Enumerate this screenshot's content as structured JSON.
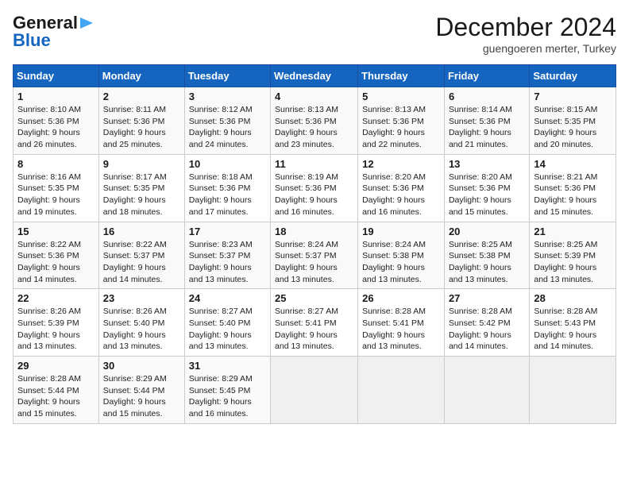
{
  "header": {
    "logo_general": "General",
    "logo_blue": "Blue",
    "title": "December 2024",
    "subtitle": "guengoeren merter, Turkey"
  },
  "calendar": {
    "days_of_week": [
      "Sunday",
      "Monday",
      "Tuesday",
      "Wednesday",
      "Thursday",
      "Friday",
      "Saturday"
    ],
    "weeks": [
      [
        null,
        {
          "day": "2",
          "sunrise": "8:11 AM",
          "sunset": "5:36 PM",
          "daylight": "9 hours and 25 minutes."
        },
        {
          "day": "3",
          "sunrise": "8:12 AM",
          "sunset": "5:36 PM",
          "daylight": "9 hours and 24 minutes."
        },
        {
          "day": "4",
          "sunrise": "8:13 AM",
          "sunset": "5:36 PM",
          "daylight": "9 hours and 23 minutes."
        },
        {
          "day": "5",
          "sunrise": "8:13 AM",
          "sunset": "5:36 PM",
          "daylight": "9 hours and 22 minutes."
        },
        {
          "day": "6",
          "sunrise": "8:14 AM",
          "sunset": "5:36 PM",
          "daylight": "9 hours and 21 minutes."
        },
        {
          "day": "7",
          "sunrise": "8:15 AM",
          "sunset": "5:35 PM",
          "daylight": "9 hours and 20 minutes."
        }
      ],
      [
        {
          "day": "1",
          "sunrise": "8:10 AM",
          "sunset": "5:36 PM",
          "daylight": "9 hours and 26 minutes."
        },
        {
          "day": "9",
          "sunrise": "8:17 AM",
          "sunset": "5:35 PM",
          "daylight": "9 hours and 18 minutes."
        },
        {
          "day": "10",
          "sunrise": "8:18 AM",
          "sunset": "5:36 PM",
          "daylight": "9 hours and 17 minutes."
        },
        {
          "day": "11",
          "sunrise": "8:19 AM",
          "sunset": "5:36 PM",
          "daylight": "9 hours and 16 minutes."
        },
        {
          "day": "12",
          "sunrise": "8:20 AM",
          "sunset": "5:36 PM",
          "daylight": "9 hours and 16 minutes."
        },
        {
          "day": "13",
          "sunrise": "8:20 AM",
          "sunset": "5:36 PM",
          "daylight": "9 hours and 15 minutes."
        },
        {
          "day": "14",
          "sunrise": "8:21 AM",
          "sunset": "5:36 PM",
          "daylight": "9 hours and 15 minutes."
        }
      ],
      [
        {
          "day": "8",
          "sunrise": "8:16 AM",
          "sunset": "5:35 PM",
          "daylight": "9 hours and 19 minutes."
        },
        {
          "day": "16",
          "sunrise": "8:22 AM",
          "sunset": "5:37 PM",
          "daylight": "9 hours and 14 minutes."
        },
        {
          "day": "17",
          "sunrise": "8:23 AM",
          "sunset": "5:37 PM",
          "daylight": "9 hours and 13 minutes."
        },
        {
          "day": "18",
          "sunrise": "8:24 AM",
          "sunset": "5:37 PM",
          "daylight": "9 hours and 13 minutes."
        },
        {
          "day": "19",
          "sunrise": "8:24 AM",
          "sunset": "5:38 PM",
          "daylight": "9 hours and 13 minutes."
        },
        {
          "day": "20",
          "sunrise": "8:25 AM",
          "sunset": "5:38 PM",
          "daylight": "9 hours and 13 minutes."
        },
        {
          "day": "21",
          "sunrise": "8:25 AM",
          "sunset": "5:39 PM",
          "daylight": "9 hours and 13 minutes."
        }
      ],
      [
        {
          "day": "15",
          "sunrise": "8:22 AM",
          "sunset": "5:36 PM",
          "daylight": "9 hours and 14 minutes."
        },
        {
          "day": "23",
          "sunrise": "8:26 AM",
          "sunset": "5:40 PM",
          "daylight": "9 hours and 13 minutes."
        },
        {
          "day": "24",
          "sunrise": "8:27 AM",
          "sunset": "5:40 PM",
          "daylight": "9 hours and 13 minutes."
        },
        {
          "day": "25",
          "sunrise": "8:27 AM",
          "sunset": "5:41 PM",
          "daylight": "9 hours and 13 minutes."
        },
        {
          "day": "26",
          "sunrise": "8:28 AM",
          "sunset": "5:41 PM",
          "daylight": "9 hours and 13 minutes."
        },
        {
          "day": "27",
          "sunrise": "8:28 AM",
          "sunset": "5:42 PM",
          "daylight": "9 hours and 14 minutes."
        },
        {
          "day": "28",
          "sunrise": "8:28 AM",
          "sunset": "5:43 PM",
          "daylight": "9 hours and 14 minutes."
        }
      ],
      [
        {
          "day": "22",
          "sunrise": "8:26 AM",
          "sunset": "5:39 PM",
          "daylight": "9 hours and 13 minutes."
        },
        {
          "day": "30",
          "sunrise": "8:29 AM",
          "sunset": "5:44 PM",
          "daylight": "9 hours and 15 minutes."
        },
        {
          "day": "31",
          "sunrise": "8:29 AM",
          "sunset": "5:45 PM",
          "daylight": "9 hours and 16 minutes."
        },
        null,
        null,
        null,
        null
      ],
      [
        {
          "day": "29",
          "sunrise": "8:28 AM",
          "sunset": "5:44 PM",
          "daylight": "9 hours and 15 minutes."
        },
        null,
        null,
        null,
        null,
        null,
        null
      ]
    ]
  }
}
